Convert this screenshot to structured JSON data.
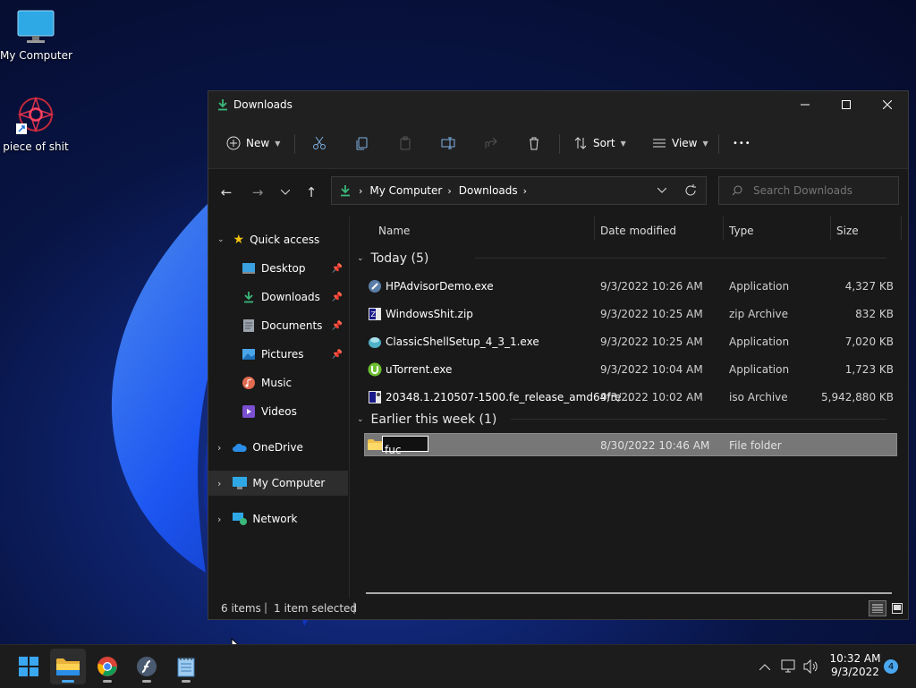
{
  "desktop": {
    "icons": [
      {
        "label": "My Computer",
        "icon": "monitor-icon"
      },
      {
        "label": "piece of shit",
        "icon": "shortcut-icon"
      }
    ]
  },
  "window": {
    "title": "Downloads",
    "controls": [
      "minimize",
      "maximize",
      "close"
    ]
  },
  "toolbar": {
    "new_label": "New",
    "sort_label": "Sort",
    "view_label": "View",
    "more_label": "•••"
  },
  "address": {
    "crumbs": [
      "My Computer",
      "Downloads"
    ],
    "search_placeholder": "Search Downloads"
  },
  "sidebar": {
    "items": [
      {
        "label": "Quick access"
      },
      {
        "label": "Desktop"
      },
      {
        "label": "Downloads"
      },
      {
        "label": "Documents"
      },
      {
        "label": "Pictures"
      },
      {
        "label": "Music"
      },
      {
        "label": "Videos"
      },
      {
        "label": "OneDrive"
      },
      {
        "label": "My Computer"
      },
      {
        "label": "Network"
      }
    ]
  },
  "columns": {
    "name": "Name",
    "date": "Date modified",
    "type": "Type",
    "size": "Size"
  },
  "groups": [
    {
      "label": "Today (5)"
    },
    {
      "label": "Earlier this week (1)"
    }
  ],
  "files": [
    {
      "name": "HPAdvisorDemo.exe",
      "date": "9/3/2022 10:26 AM",
      "type": "Application",
      "size": "4,327 KB"
    },
    {
      "name": "WindowsShit.zip",
      "date": "9/3/2022 10:25 AM",
      "type": "zip Archive",
      "size": "832 KB"
    },
    {
      "name": "ClassicShellSetup_4_3_1.exe",
      "date": "9/3/2022 10:25 AM",
      "type": "Application",
      "size": "7,020 KB"
    },
    {
      "name": "uTorrent.exe",
      "date": "9/3/2022 10:04 AM",
      "type": "Application",
      "size": "1,723 KB"
    },
    {
      "name": "20348.1.210507-1500.fe_release_amd64fre...",
      "date": "9/3/2022 10:02 AM",
      "type": "iso Archive",
      "size": "5,942,880 KB"
    },
    {
      "name": "fuc",
      "date": "8/30/2022 10:46 AM",
      "type": "File folder",
      "size": ""
    }
  ],
  "status": {
    "count": "6 items",
    "selected": "1 item selected"
  },
  "taskbar": {
    "time": "10:32 AM",
    "date": "9/3/2022",
    "notifications": "4"
  },
  "colors": {
    "accent": "#0078d4",
    "selected_row": "#777777"
  }
}
